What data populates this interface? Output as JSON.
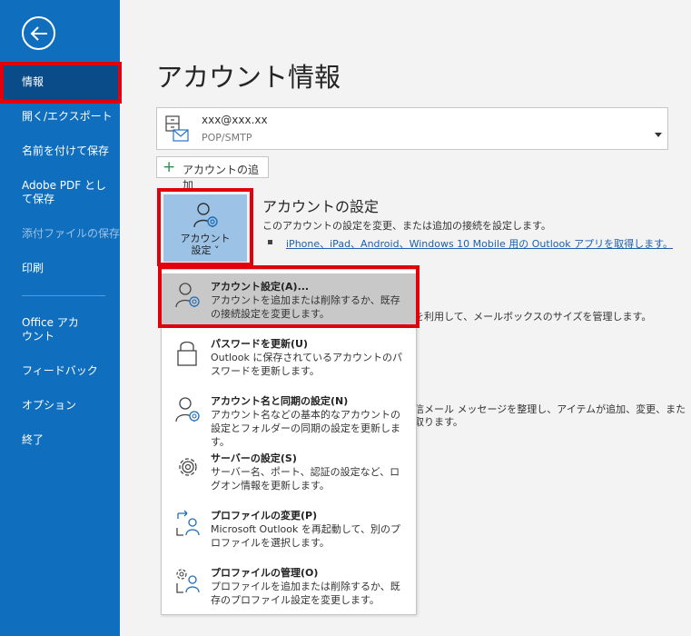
{
  "sidebar": {
    "items": [
      {
        "label": "情報"
      },
      {
        "label": "開く/エクスポート"
      },
      {
        "label": "名前を付けて保存"
      },
      {
        "label": "Adobe PDF として保存"
      },
      {
        "label": "添付ファイルの保存"
      },
      {
        "label": "印刷"
      },
      {
        "label": "Office アカウント"
      },
      {
        "label": "フィードバック"
      },
      {
        "label": "オプション"
      },
      {
        "label": "終了"
      }
    ],
    "color": "#106ebe"
  },
  "main": {
    "title": "アカウント情報",
    "account": {
      "email": "xxx@xxx.xx",
      "type": "POP/SMTP"
    },
    "add_account_label": "アカウントの追加",
    "settings_tile_label_1": "アカウント",
    "settings_tile_label_2": "設定 ˅",
    "section_title": "アカウントの設定",
    "section_desc": "このアカウントの設定を変更、または追加の接続を設定します。",
    "section_link": "iPhone、iPad、Android、Windows 10 Mobile 用の Outlook アプリを取得します。",
    "bg_text_1": "を利用して、メールボックスのサイズを管理します。",
    "bg_text_2": "信メール メッセージを整理し、アイテムが追加、変更、また",
    "bg_text_3": "取ります。"
  },
  "menu": {
    "items": [
      {
        "title": "アカウント設定(A)...",
        "desc": "アカウントを追加または削除するか、既存の接続設定を変更します。",
        "icon": "account-settings-icon"
      },
      {
        "title": "パスワードを更新(U)",
        "desc": "Outlook に保存されているアカウントのパスワードを更新します。",
        "icon": "lock-icon"
      },
      {
        "title": "アカウント名と同期の設定(N)",
        "desc": "アカウント名などの基本的なアカウントの設定とフォルダーの同期の設定を更新します。",
        "icon": "account-sync-icon"
      },
      {
        "title": "サーバーの設定(S)",
        "desc": "サーバー名、ポート、認証の設定など、ログオン情報を更新します。",
        "icon": "gear-icon"
      },
      {
        "title": "プロファイルの変更(P)",
        "desc": "Microsoft Outlook を再起動して、別のプロファイルを選択します。",
        "icon": "profile-change-icon"
      },
      {
        "title": "プロファイルの管理(O)",
        "desc": "プロファイルを追加または削除するか、既存のプロファイル設定を変更します。",
        "icon": "profile-manage-icon"
      }
    ]
  },
  "colors": {
    "accent": "#106ebe",
    "highlight": "#e0000e",
    "tile": "#9cc3e6"
  }
}
